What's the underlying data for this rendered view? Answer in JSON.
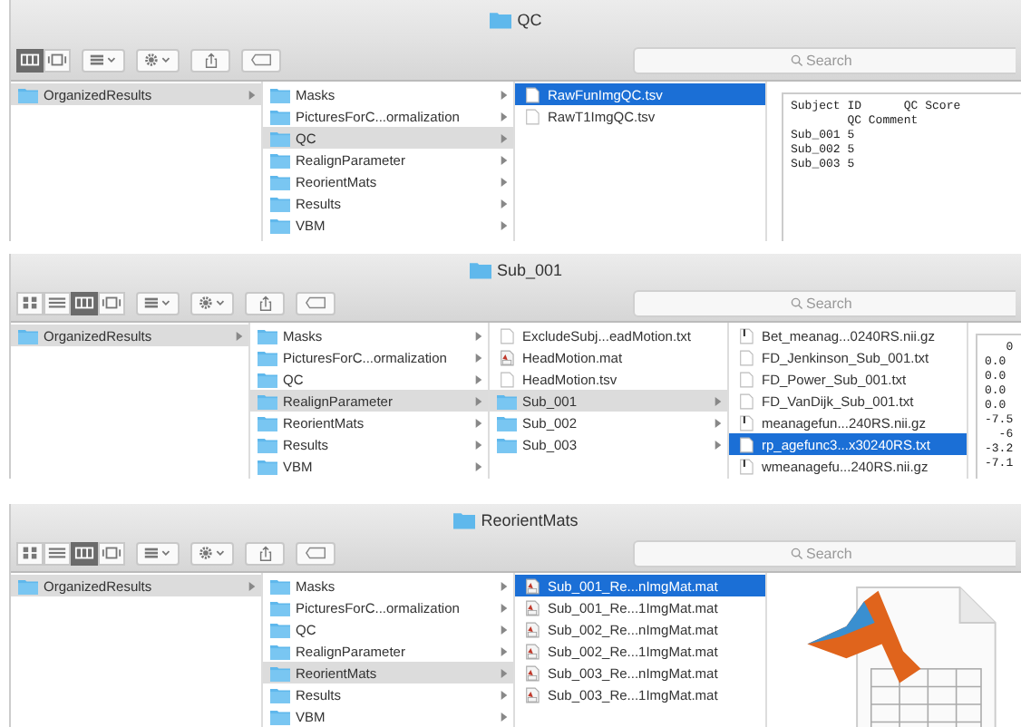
{
  "windows": [
    {
      "title": "QC",
      "view_buttons": [
        {
          "kind": "columns",
          "selected": true
        },
        {
          "kind": "coverflow",
          "selected": false
        }
      ],
      "search": {
        "placeholder": "Search"
      },
      "columns": [
        {
          "focused": false,
          "items": [
            {
              "name": "OrganizedResults",
              "kind": "folder",
              "selected": true
            }
          ]
        },
        {
          "focused": false,
          "items": [
            {
              "name": "Masks",
              "kind": "folder",
              "selected": false
            },
            {
              "name": "PicturesForC...ormalization",
              "kind": "folder",
              "selected": false
            },
            {
              "name": "QC",
              "kind": "folder",
              "selected": true
            },
            {
              "name": "RealignParameter",
              "kind": "folder",
              "selected": false
            },
            {
              "name": "ReorientMats",
              "kind": "folder",
              "selected": false
            },
            {
              "name": "Results",
              "kind": "folder",
              "selected": false
            },
            {
              "name": "VBM",
              "kind": "folder",
              "selected": false
            }
          ]
        },
        {
          "focused": true,
          "items": [
            {
              "name": "RawFunImgQC.tsv",
              "kind": "file",
              "selected": true
            },
            {
              "name": "RawT1ImgQC.tsv",
              "kind": "file",
              "selected": false
            }
          ]
        }
      ],
      "preview": {
        "kind": "text",
        "lines": [
          "Subject ID      QC Score",
          "        QC Comment",
          "Sub_001 5",
          "Sub_002 5",
          "Sub_003 5"
        ]
      }
    },
    {
      "title": "Sub_001",
      "view_buttons": [
        {
          "kind": "icons",
          "selected": false
        },
        {
          "kind": "list",
          "selected": false
        },
        {
          "kind": "columns",
          "selected": true
        },
        {
          "kind": "coverflow",
          "selected": false
        }
      ],
      "search": {
        "placeholder": "Search"
      },
      "columns": [
        {
          "focused": false,
          "items": [
            {
              "name": "OrganizedResults",
              "kind": "folder",
              "selected": true
            }
          ]
        },
        {
          "focused": false,
          "items": [
            {
              "name": "Masks",
              "kind": "folder",
              "selected": false
            },
            {
              "name": "PicturesForC...ormalization",
              "kind": "folder",
              "selected": false
            },
            {
              "name": "QC",
              "kind": "folder",
              "selected": false
            },
            {
              "name": "RealignParameter",
              "kind": "folder",
              "selected": true
            },
            {
              "name": "ReorientMats",
              "kind": "folder",
              "selected": false
            },
            {
              "name": "Results",
              "kind": "folder",
              "selected": false
            },
            {
              "name": "VBM",
              "kind": "folder",
              "selected": false
            }
          ]
        },
        {
          "focused": false,
          "items": [
            {
              "name": "ExcludeSubj...eadMotion.txt",
              "kind": "file",
              "selected": false
            },
            {
              "name": "HeadMotion.mat",
              "kind": "mat",
              "selected": false
            },
            {
              "name": "HeadMotion.tsv",
              "kind": "file",
              "selected": false
            },
            {
              "name": "Sub_001",
              "kind": "folder",
              "selected": true
            },
            {
              "name": "Sub_002",
              "kind": "folder",
              "selected": false
            },
            {
              "name": "Sub_003",
              "kind": "folder",
              "selected": false
            }
          ]
        },
        {
          "focused": true,
          "items": [
            {
              "name": "Bet_meanag...0240RS.nii.gz",
              "kind": "archive",
              "selected": false
            },
            {
              "name": "FD_Jenkinson_Sub_001.txt",
              "kind": "file",
              "selected": false
            },
            {
              "name": "FD_Power_Sub_001.txt",
              "kind": "file",
              "selected": false
            },
            {
              "name": "FD_VanDijk_Sub_001.txt",
              "kind": "file",
              "selected": false
            },
            {
              "name": "meanagefun...240RS.nii.gz",
              "kind": "archive",
              "selected": false
            },
            {
              "name": "rp_agefunc3...x30240RS.txt",
              "kind": "file",
              "selected": true
            },
            {
              "name": "wmeanagefu...240RS.nii.gz",
              "kind": "archive",
              "selected": false
            }
          ]
        }
      ],
      "preview": {
        "kind": "text",
        "lines": [
          "   0",
          "0.0",
          "0.0",
          "0.0",
          "0.0",
          "-7.5",
          "  -6",
          "-3.2",
          "-7.1"
        ]
      }
    },
    {
      "title": "ReorientMats",
      "view_buttons": [
        {
          "kind": "icons",
          "selected": false
        },
        {
          "kind": "list",
          "selected": false
        },
        {
          "kind": "columns",
          "selected": true
        },
        {
          "kind": "coverflow",
          "selected": false
        }
      ],
      "search": {
        "placeholder": "Search"
      },
      "columns": [
        {
          "focused": false,
          "items": [
            {
              "name": "OrganizedResults",
              "kind": "folder",
              "selected": true
            }
          ]
        },
        {
          "focused": false,
          "items": [
            {
              "name": "Masks",
              "kind": "folder",
              "selected": false
            },
            {
              "name": "PicturesForC...ormalization",
              "kind": "folder",
              "selected": false
            },
            {
              "name": "QC",
              "kind": "folder",
              "selected": false
            },
            {
              "name": "RealignParameter",
              "kind": "folder",
              "selected": false
            },
            {
              "name": "ReorientMats",
              "kind": "folder",
              "selected": true
            },
            {
              "name": "Results",
              "kind": "folder",
              "selected": false
            },
            {
              "name": "VBM",
              "kind": "folder",
              "selected": false
            }
          ]
        },
        {
          "focused": true,
          "items": [
            {
              "name": "Sub_001_Re...nImgMat.mat",
              "kind": "mat",
              "selected": true
            },
            {
              "name": "Sub_001_Re...1ImgMat.mat",
              "kind": "mat",
              "selected": false
            },
            {
              "name": "Sub_002_Re...nImgMat.mat",
              "kind": "mat",
              "selected": false
            },
            {
              "name": "Sub_002_Re...1ImgMat.mat",
              "kind": "mat",
              "selected": false
            },
            {
              "name": "Sub_003_Re...nImgMat.mat",
              "kind": "mat",
              "selected": false
            },
            {
              "name": "Sub_003_Re...1ImgMat.mat",
              "kind": "mat",
              "selected": false
            }
          ]
        }
      ],
      "preview": {
        "kind": "document-icon"
      }
    }
  ]
}
